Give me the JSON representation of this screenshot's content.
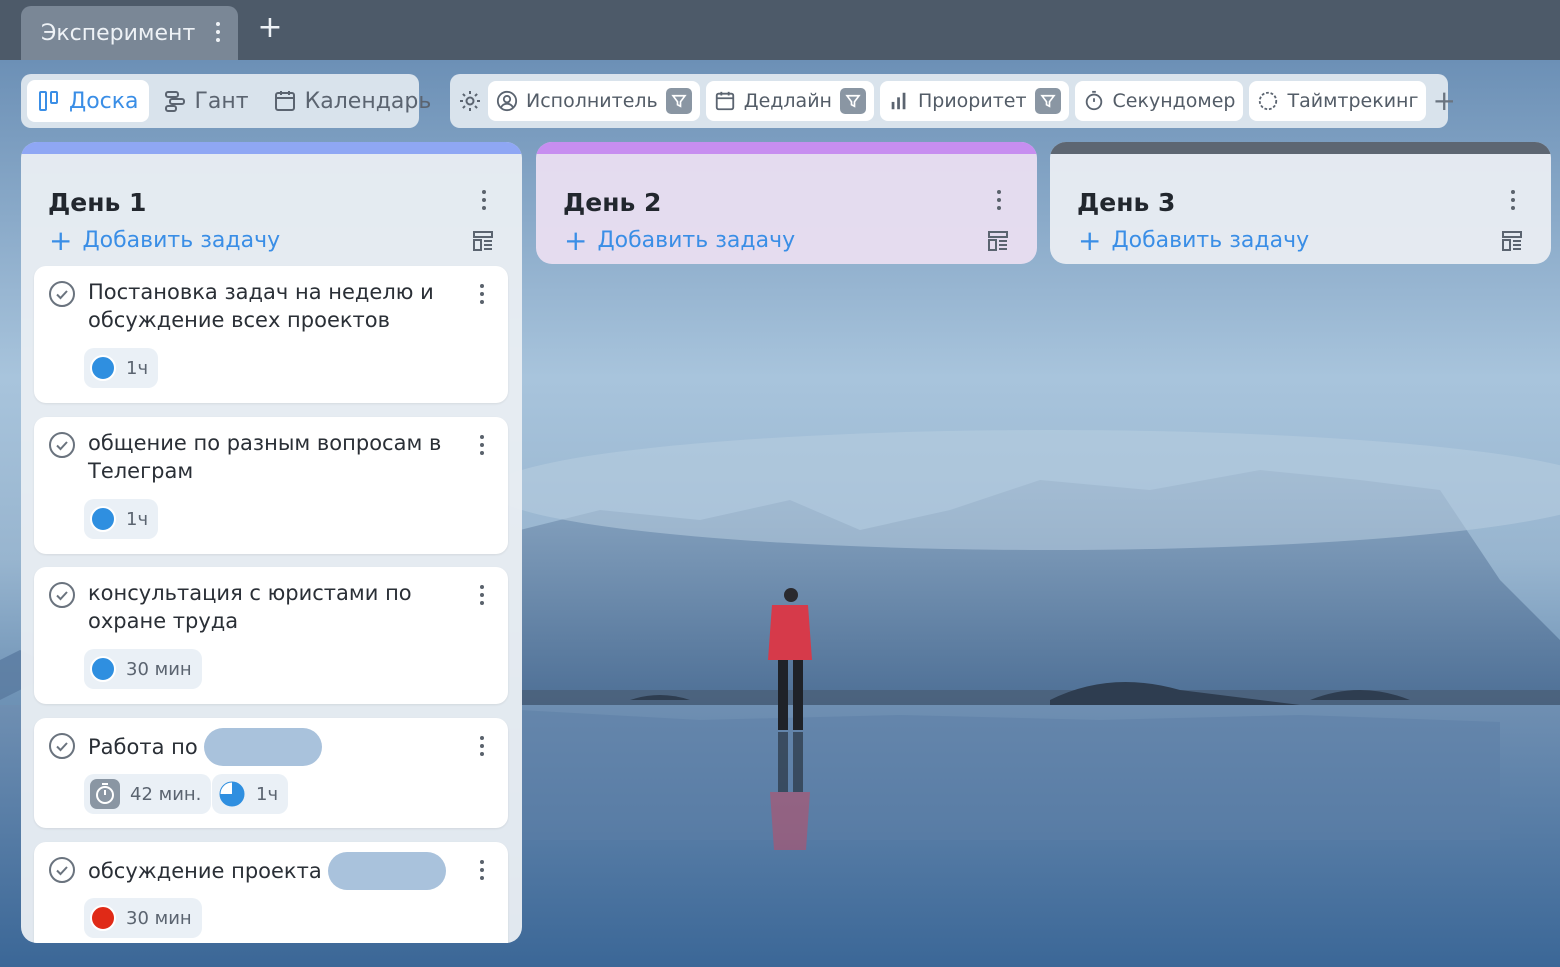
{
  "tabs": {
    "active_label": "Эксперимент",
    "add_label": "+"
  },
  "views": [
    {
      "label": "Доска",
      "icon": "board-icon",
      "active": true
    },
    {
      "label": "Гант",
      "icon": "gantt-icon",
      "active": false
    },
    {
      "label": "Календарь",
      "icon": "calendar-icon",
      "active": false
    }
  ],
  "filters": {
    "assignee": "Исполнитель",
    "deadline": "Дедлайн",
    "priority": "Приоритет",
    "stopwatch": "Секундомер",
    "timetracking": "Таймтрекинг",
    "add_label": "+"
  },
  "columns": [
    {
      "title": "День 1",
      "add_task": "Добавить задачу",
      "accent": "#8fa7f4"
    },
    {
      "title": "День 2",
      "add_task": "Добавить задачу",
      "accent": "#c78ef0"
    },
    {
      "title": "День 3",
      "add_task": "Добавить задачу",
      "accent": "#5d6672"
    }
  ],
  "cards": [
    {
      "title": "Постановка задач на неделю и обсуждение всех проектов",
      "estimate": "1ч"
    },
    {
      "title": "общение по разным вопросам в Телеграм",
      "estimate": "1ч"
    },
    {
      "title": "консультация с юристами по охране труда",
      "estimate": "30 мин"
    },
    {
      "title": "Работа по",
      "timer": "42 мин.",
      "estimate": "1ч"
    },
    {
      "title": "обсуждение проекта",
      "estimate": "30 мин"
    }
  ],
  "colors": {
    "accent_blue": "#3a8ee6",
    "dot_blue": "#2f8fe0",
    "dot_red": "#e02a17"
  }
}
